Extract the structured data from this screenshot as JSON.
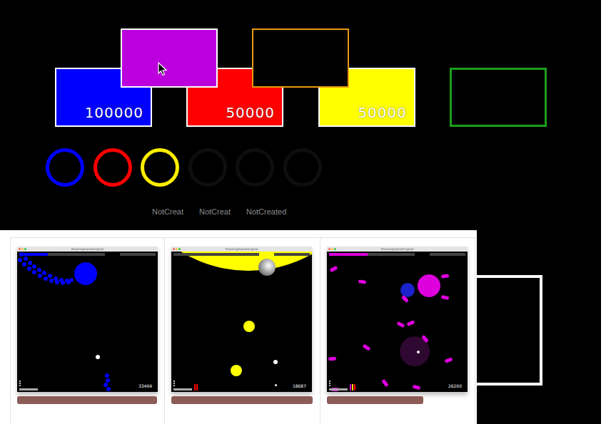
{
  "cards": [
    {
      "value": "100000",
      "color": "#0000ff",
      "border": "#ffffff"
    },
    {
      "value": "50000",
      "color": "#ff0000",
      "border": "#ffffff"
    },
    {
      "value": "50000",
      "color": "#ffff00",
      "border": "#ffffff"
    },
    {
      "value": "",
      "color": "#000000",
      "border": "#1a9e1a"
    },
    {
      "value": "",
      "color": "#bb00dd",
      "border": "#ffffff"
    },
    {
      "value": "",
      "color": "#000000",
      "border": "#e89a10"
    }
  ],
  "rings": [
    {
      "created": true,
      "color": "#0000ff",
      "label": ""
    },
    {
      "created": true,
      "color": "#ff0000",
      "label": ""
    },
    {
      "created": true,
      "color": "#ffee00",
      "label": ""
    },
    {
      "created": false,
      "color": "#0e0e0e",
      "label": "NotCreat"
    },
    {
      "created": false,
      "color": "#0e0e0e",
      "label": "NotCreat"
    },
    {
      "created": false,
      "color": "#0e0e0e",
      "label": "NotCreated"
    }
  ],
  "screenshots": [
    {
      "title": "ShootingGameOriginal",
      "score": "33499",
      "color": "#0000ff",
      "level": 0.33,
      "timeline": 1,
      "meters": []
    },
    {
      "title": "ShootingGameOriginal",
      "score": "18687",
      "color": "#ffff00",
      "level": 0,
      "timeline": 1,
      "meters": [
        "#ff0000",
        "#ff0000"
      ]
    },
    {
      "title": "ShootingGameOriginal",
      "score": "26200",
      "color": "#dd00dd",
      "level": 0.45,
      "timeline": 0.68,
      "meters": [
        "#dd00dd",
        "#ffdd00",
        "#ff0000"
      ]
    }
  ]
}
